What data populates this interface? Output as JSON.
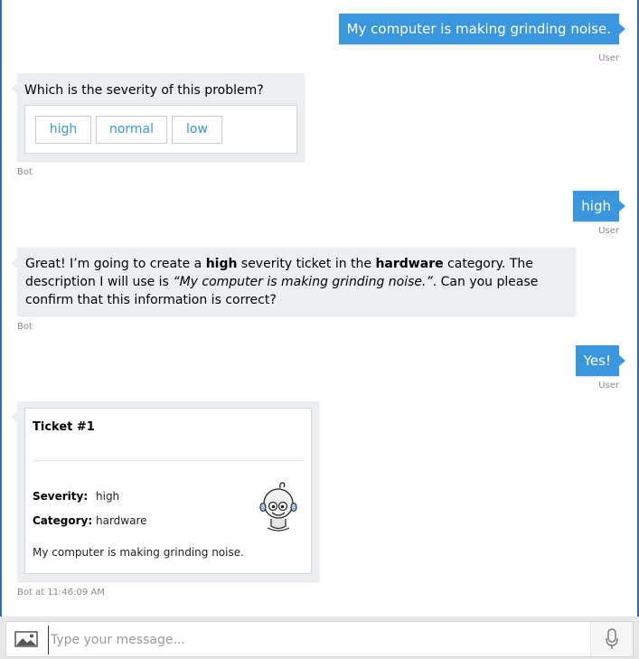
{
  "conversation": {
    "msg1": {
      "text": "My computer is making grinding noise.",
      "sender": "User"
    },
    "msg2": {
      "text": "Which is the severity of this problem?",
      "choices": [
        "high",
        "normal",
        "low"
      ],
      "sender": "Bot"
    },
    "msg3": {
      "text": "high",
      "sender": "User"
    },
    "msg4": {
      "part1": "Great! I’m going to create a ",
      "severity": "high",
      "part2": " severity ticket in the ",
      "category": "hardware",
      "part3": " category. The description I will use is ",
      "description": "“My computer is making grinding noise.”",
      "part4": ". Can you please confirm that this information is correct?",
      "sender": "Bot"
    },
    "msg5": {
      "text": "Yes!",
      "sender": "User"
    },
    "msg6": {
      "title": "Ticket #1",
      "severity_label": "Severity:",
      "severity_value": "high",
      "category_label": "Category:",
      "category_value": "hardware",
      "description": "My computer is making grinding noise.",
      "image_icon": "robot-mascot-icon",
      "sender": "Bot at 11:46:09 AM"
    }
  },
  "composer": {
    "placeholder": "Type your message...",
    "upload_icon": "image-upload-icon",
    "mic_icon": "microphone-icon"
  },
  "colors": {
    "user_bubble": "#3a96dd",
    "bot_bubble": "#eceff1",
    "accent_link": "#3a96dd",
    "frame": "#2e6db4"
  }
}
